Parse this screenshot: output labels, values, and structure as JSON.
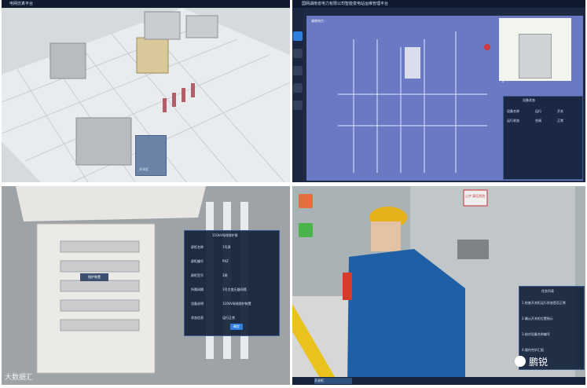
{
  "q1": {
    "app_title": "电网仿真平台",
    "card_label": "开关柜"
  },
  "q2": {
    "app_title": "国网湖南省电力有限公司智能变电站运维管理平台",
    "diagram_logo": "湖南电力",
    "state_panel": {
      "title": "设备状态",
      "row1": [
        "设备名称",
        "运行",
        "开关"
      ],
      "row2": [
        "运行状态",
        "合闸",
        "正常"
      ]
    }
  },
  "q3": {
    "popup": {
      "title": "110kV母线保护屏",
      "fields": [
        {
          "k": "屏柜名称",
          "v": "1号屏"
        },
        {
          "k": "屏柜编号",
          "v": "P4Z"
        },
        {
          "k": "屏柜型号",
          "v": "3屏"
        },
        {
          "k": "所属间隔",
          "v": "1号主变压器间隔"
        },
        {
          "k": "设备说明",
          "v": "110kV母线保护装置"
        },
        {
          "k": "状态信息",
          "v": "运行正常"
        }
      ],
      "button": "确定"
    },
    "tag": "保护装置",
    "watermark": "大数据汇"
  },
  "q4": {
    "warn_sign": "止步 高压危险",
    "right_panel": {
      "title": "任务列表",
      "items": [
        "1.检查开关柜运行状态是否正常",
        "2.确认开关柜位置指示",
        "3.核对设备名称编号",
        "4.操作完毕汇报"
      ]
    },
    "bottom_select": "开关柜",
    "wechat_label": "鹏锐"
  },
  "colors": {
    "accent": "#2f7fe0",
    "helmet": "#e5b21b",
    "suit": "#1f5fa6"
  }
}
